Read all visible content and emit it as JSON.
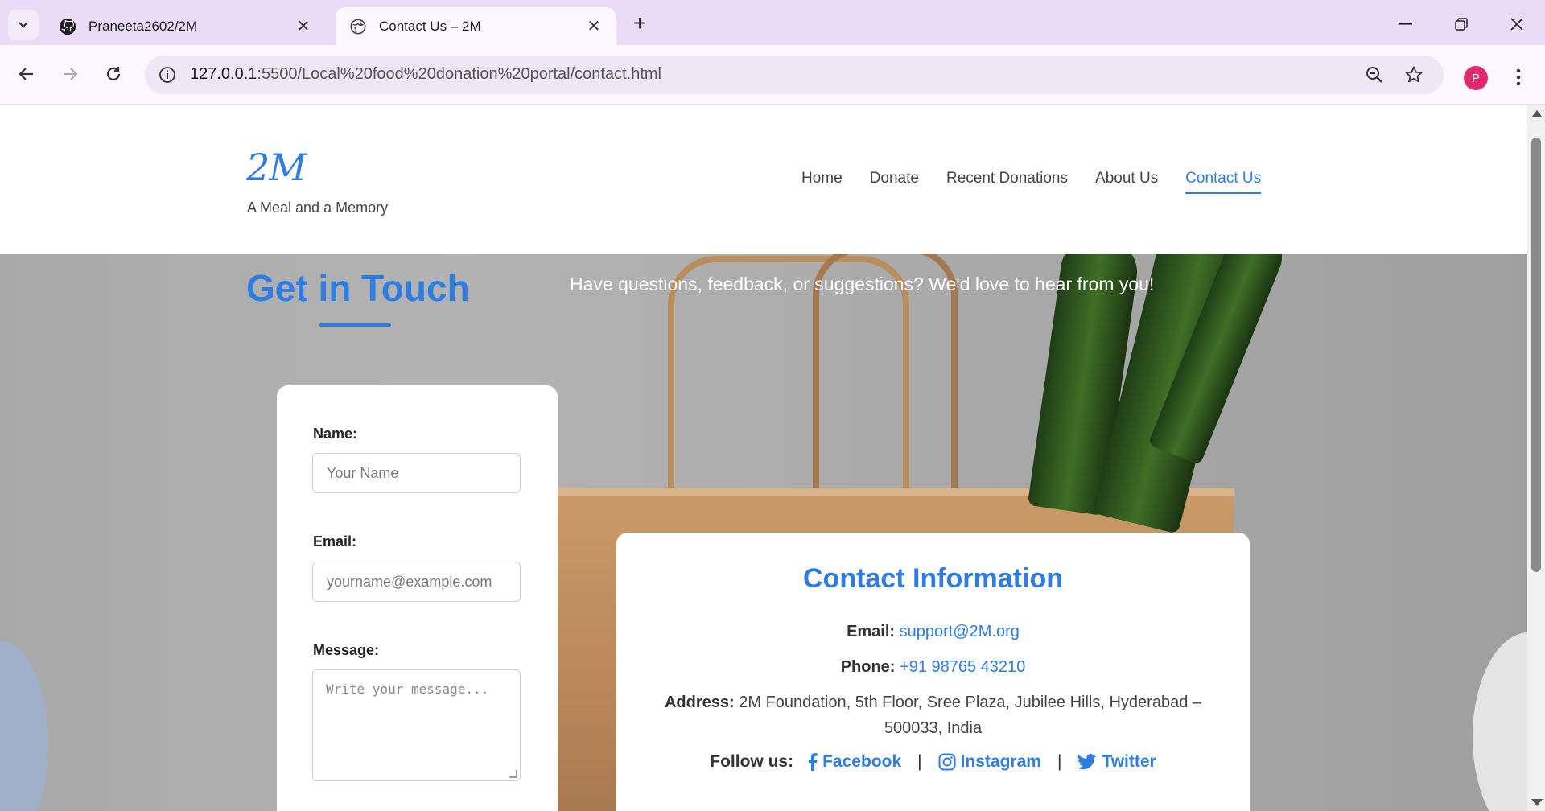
{
  "browser": {
    "tabs": [
      {
        "title": "Praneeta2602/2M",
        "icon": "github-icon",
        "active": false
      },
      {
        "title": "Contact Us – 2M",
        "icon": "globe-icon",
        "active": true
      }
    ],
    "url_host": "127.0.0.1",
    "url_path": ":5500/Local%20food%20donation%20portal/contact.html",
    "profile_initial": "P"
  },
  "site": {
    "logo": "2M",
    "tagline": "A Meal and a Memory",
    "nav": [
      "Home",
      "Donate",
      "Recent Donations",
      "About Us",
      "Contact Us"
    ],
    "active_nav": "Contact Us"
  },
  "hero": {
    "title": "Get in Touch",
    "subtitle": "Have questions, feedback, or suggestions? We'd love to hear from you!"
  },
  "form": {
    "name_label": "Name:",
    "name_placeholder": "Your Name",
    "email_label": "Email:",
    "email_placeholder": "yourname@example.com",
    "message_label": "Message:",
    "message_placeholder": "Write your message..."
  },
  "contact": {
    "title": "Contact Information",
    "email_label": "Email:",
    "email": "support@2M.org",
    "phone_label": "Phone:",
    "phone": "+91 98765 43210",
    "address_label": "Address:",
    "address_line1": "2M Foundation, 5th Floor, Sree Plaza, Jubilee Hills, Hyderabad –",
    "address_line2": "500033, India",
    "follow_label": "Follow us:",
    "social": [
      "Facebook",
      "Instagram",
      "Twitter"
    ],
    "separator": "|"
  },
  "colors": {
    "accent": "#2f7de1",
    "chrome": "#eadcf6"
  }
}
